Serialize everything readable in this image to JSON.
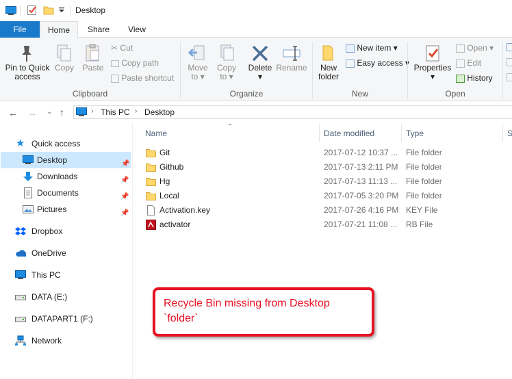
{
  "window": {
    "title": "Desktop"
  },
  "tabs": {
    "file": "File",
    "home": "Home",
    "share": "Share",
    "view": "View"
  },
  "ribbon": {
    "clipboard": {
      "label": "Clipboard",
      "pin_l1": "Pin to Quick",
      "pin_l2": "access",
      "copy": "Copy",
      "paste": "Paste",
      "cut": "Cut",
      "copy_path": "Copy path",
      "paste_shortcut": "Paste shortcut"
    },
    "organize": {
      "label": "Organize",
      "move_l1": "Move",
      "move_l2": "to",
      "copy_l1": "Copy",
      "copy_l2": "to",
      "delete": "Delete",
      "rename": "Rename"
    },
    "new": {
      "label": "New",
      "new_folder_l1": "New",
      "new_folder_l2": "folder",
      "new_item": "New item",
      "easy_access": "Easy access"
    },
    "open": {
      "label": "Open",
      "properties": "Properties",
      "open": "Open",
      "edit": "Edit",
      "history": "History"
    }
  },
  "address": {
    "crumbs": [
      "This PC",
      "Desktop"
    ]
  },
  "nav": {
    "quick_access": "Quick access",
    "desktop": "Desktop",
    "downloads": "Downloads",
    "documents": "Documents",
    "pictures": "Pictures",
    "dropbox": "Dropbox",
    "onedrive": "OneDrive",
    "this_pc": "This PC",
    "data_e": "DATA (E:)",
    "datapart1_f": "DATAPART1 (F:)",
    "network": "Network"
  },
  "columns": {
    "name": "Name",
    "date": "Date modified",
    "type": "Type",
    "size": "S"
  },
  "files": [
    {
      "name": "Git",
      "date": "2017-07-12 10:37 ...",
      "type": "File folder"
    },
    {
      "name": "Github",
      "date": "2017-07-13 2:11 PM",
      "type": "File folder"
    },
    {
      "name": "Hg",
      "date": "2017-07-13 11:13 ...",
      "type": "File folder"
    },
    {
      "name": "Local",
      "date": "2017-07-05 3:20 PM",
      "type": "File folder"
    },
    {
      "name": "Activation.key",
      "date": "2017-07-26 4:16 PM",
      "type": "KEY File"
    },
    {
      "name": "activator",
      "date": "2017-07-21 11:08 ...",
      "type": "RB File"
    }
  ],
  "callout": {
    "line1": "Recycle Bin missing from Desktop",
    "line2": "`folder`"
  },
  "colors": {
    "accent": "#1979ca",
    "callout": "#e81123",
    "folder": "#ffd86e",
    "selected": "#cce8ff"
  }
}
